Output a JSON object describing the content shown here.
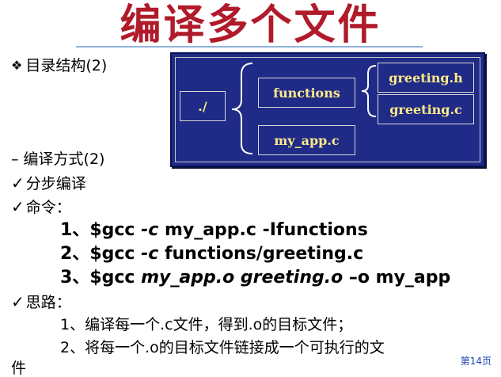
{
  "title": "编译多个文件",
  "section_dir": {
    "bullet_icon": "diamond-cluster-icon",
    "label": "目录结构(2)"
  },
  "diagram": {
    "root": "./",
    "folder": "functions",
    "file_main": "my_app.c",
    "file_header": "greeting.h",
    "file_source": "greeting.c"
  },
  "section_compile": {
    "label": "– 编译方式(2)"
  },
  "step_mode": {
    "icon": "checkmark-icon",
    "label": "分步编译"
  },
  "commands": {
    "icon": "checkmark-icon",
    "label": "命令：",
    "items": [
      {
        "num": "1、",
        "pre": "$gcc ",
        "flag": "-c",
        "rest": " my_app.c  -Ifunctions"
      },
      {
        "num": "2、",
        "pre": "$gcc ",
        "flag": "-c",
        "rest": " functions/greeting.c"
      },
      {
        "num": "3、",
        "pre": "$gcc ",
        "flag": "my_app.o greeting.o",
        "rest": " –o my_app"
      }
    ]
  },
  "thinking": {
    "icon": "checkmark-icon",
    "label": "思路：",
    "items": [
      "1、编译每一个.c文件，得到.o的目标文件；",
      "2、将每一个.o的目标文件链接成一个可执行的文",
      "件"
    ]
  },
  "page_number": "第14页"
}
